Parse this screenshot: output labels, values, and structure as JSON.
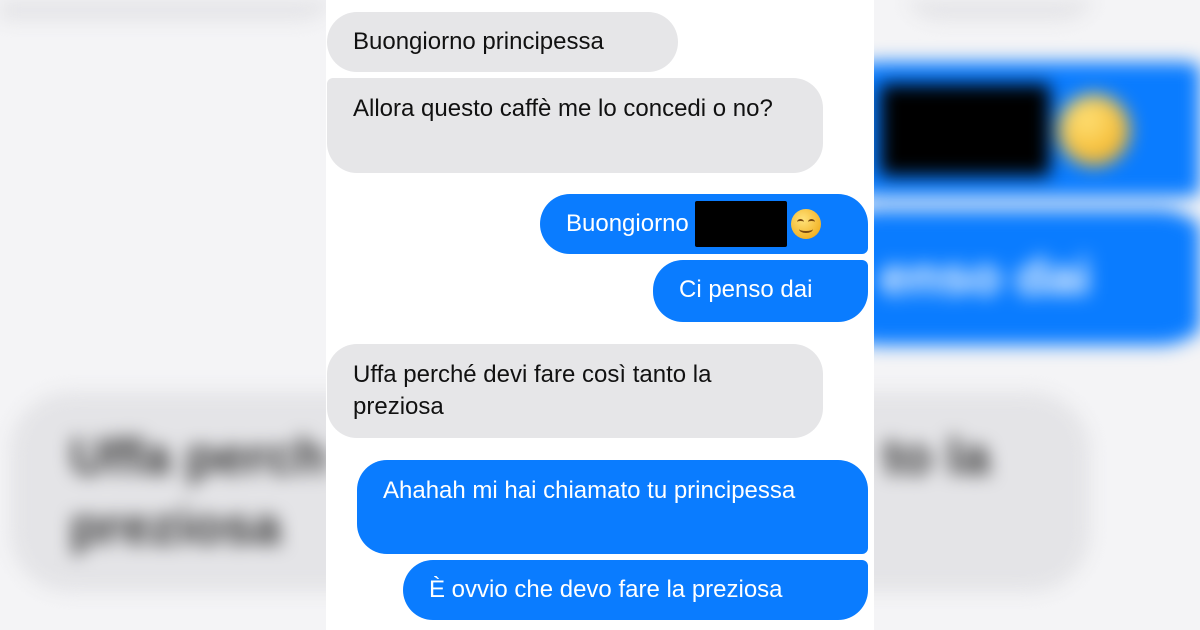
{
  "messages": [
    {
      "id": "m1",
      "direction": "incoming",
      "text": "Buongiorno principessa"
    },
    {
      "id": "m2",
      "direction": "incoming",
      "text": "Allora questo caffè me lo concedi o no?"
    },
    {
      "id": "m3",
      "direction": "outgoing",
      "text": "Buongiorno",
      "redacted": true,
      "emoji": "smiling-face-icon"
    },
    {
      "id": "m4",
      "direction": "outgoing",
      "text": "Ci penso dai"
    },
    {
      "id": "m5",
      "direction": "incoming",
      "text": "Uffa perché devi fare così tanto la preziosa"
    },
    {
      "id": "m6",
      "direction": "outgoing",
      "text": "Ahahah mi hai chiamato tu principessa"
    },
    {
      "id": "m7",
      "direction": "outgoing",
      "text": "È ovvio che devo fare la preziosa"
    }
  ],
  "background": {
    "right_blue_text": "enso dai",
    "left_grey_line1": "Uffa perch",
    "left_grey_line1_tail": "to la",
    "left_grey_line2": "preziosa"
  },
  "colors": {
    "outgoing_bubble": "#0a7cff",
    "incoming_bubble": "#e6e6e8",
    "panel": "#ffffff"
  }
}
